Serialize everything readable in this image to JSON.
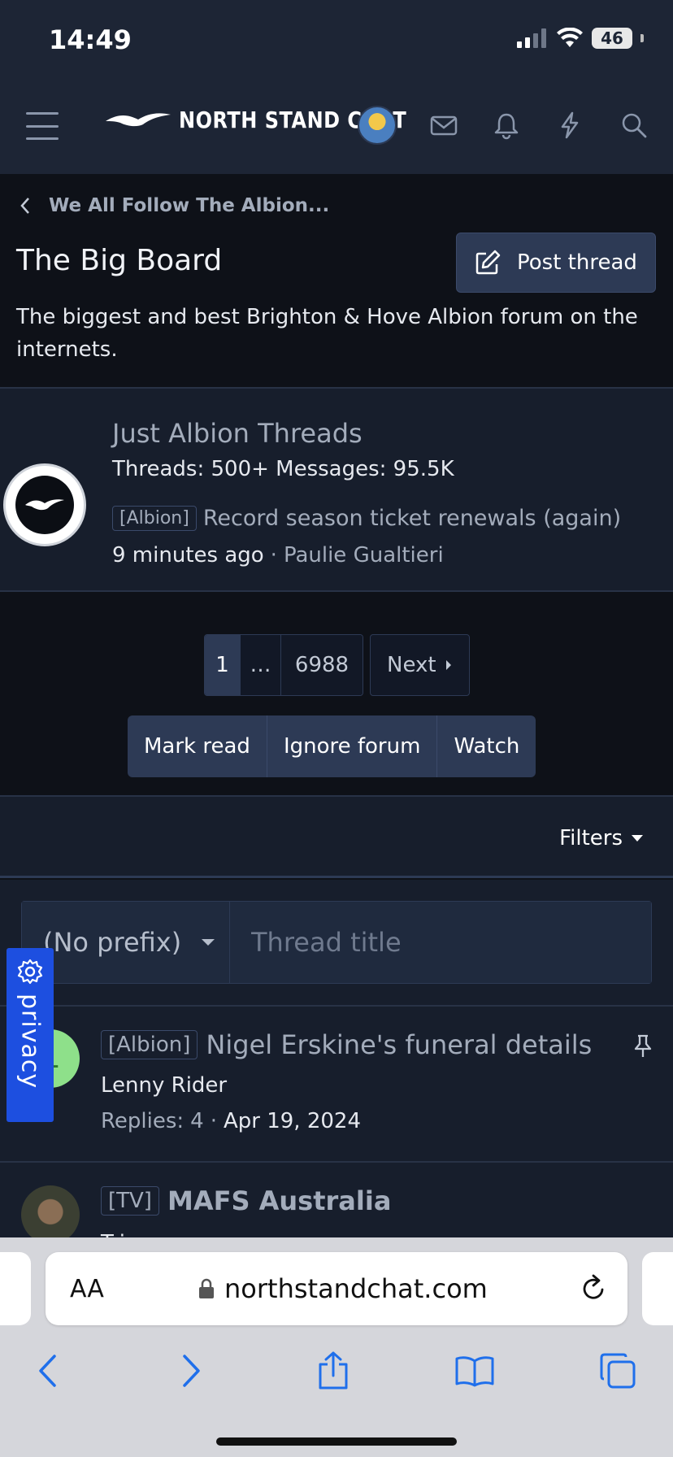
{
  "status_bar": {
    "time": "14:49",
    "battery": "46"
  },
  "header": {
    "site_name": "NORTH STAND CHAT"
  },
  "breadcrumb": {
    "label": "We All Follow The Albion..."
  },
  "page": {
    "title": "The Big Board",
    "post_thread_label": "Post thread",
    "description": "The biggest and best Brighton & Hove Albion forum on the internets."
  },
  "node": {
    "title": "Just Albion Threads",
    "stats": "Threads: 500+ Messages: 95.5K",
    "latest_prefix": "[Albion]",
    "latest_title": "Record season ticket renewals (again)",
    "latest_time": "9 minutes ago",
    "latest_sep": "·",
    "latest_author": "Paulie Gualtieri"
  },
  "pagination": {
    "pages": [
      "1",
      "…",
      "6988"
    ],
    "next_label": "Next"
  },
  "forum_actions": [
    "Mark read",
    "Ignore forum",
    "Watch"
  ],
  "filters_label": "Filters",
  "quick_thread": {
    "prefix_value": "(No prefix)",
    "title_placeholder": "Thread title"
  },
  "threads": [
    {
      "prefix": "[Albion]",
      "title": "Nigel Erskine's funeral details",
      "author": "Lenny Rider",
      "replies_label": "Replies:",
      "replies": "4",
      "sep": "·",
      "date": "Apr 19, 2024",
      "avatar_initial": "L",
      "avatar_color": "#8ee08a"
    },
    {
      "prefix": "[TV]",
      "title": "MAFS Australia",
      "author": "Tri...",
      "avatar_color": "#3b3f32"
    }
  ],
  "privacy": {
    "label": "privacy"
  },
  "safari": {
    "aa": "AA",
    "domain": "northstandchat.com"
  },
  "colors": {
    "header_bg": "#1d2535",
    "page_bg": "#0e1118",
    "card_bg": "#171e2c",
    "accent": "#2d3a55",
    "privacy_blue": "#1d4fe0"
  }
}
